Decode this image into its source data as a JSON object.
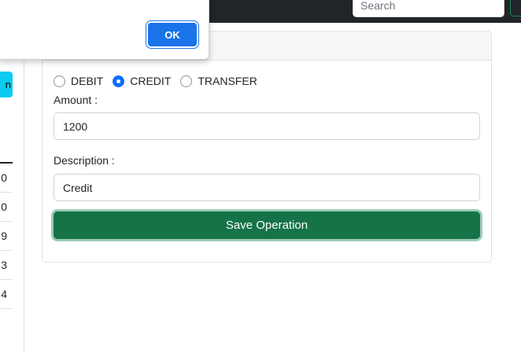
{
  "navbar": {
    "search": {
      "placeholder": "Search",
      "value": ""
    }
  },
  "sidebar": {
    "action_button_label": "n",
    "table_rows": [
      "0",
      "0",
      "9",
      "3",
      "4"
    ]
  },
  "operation_form": {
    "types": [
      {
        "label": "DEBIT",
        "checked": false
      },
      {
        "label": "CREDIT",
        "checked": true
      },
      {
        "label": "TRANSFER",
        "checked": false
      }
    ],
    "amount_label": "Amount :",
    "amount_value": "1200",
    "description_label": "Description :",
    "description_value": "Credit",
    "save_label": "Save Operation"
  },
  "dialog": {
    "ok_label": "OK"
  },
  "colors": {
    "navbar": "#212529",
    "primary": "#0d6efd",
    "success": "#157347",
    "info": "#0dcaf0",
    "dialog_button": "#1a73e8"
  }
}
